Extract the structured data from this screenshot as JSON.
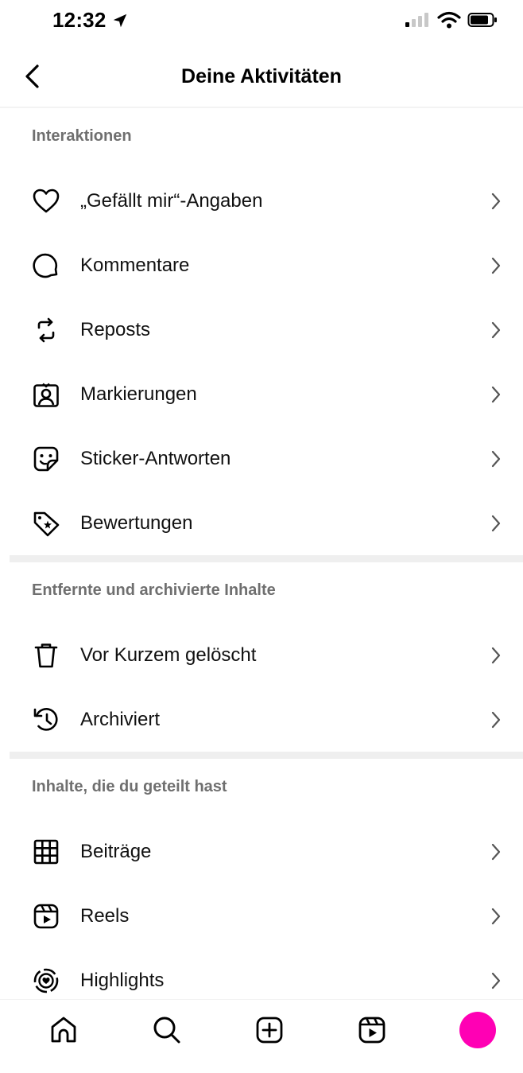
{
  "status_bar": {
    "time": "12:32"
  },
  "header": {
    "title": "Deine Aktivitäten"
  },
  "sections": [
    {
      "title": "Interaktionen",
      "items": [
        {
          "label": "„Gefällt mir“-Angaben",
          "icon": "heart-icon"
        },
        {
          "label": "Kommentare",
          "icon": "comment-icon"
        },
        {
          "label": "Reposts",
          "icon": "repost-icon"
        },
        {
          "label": "Markierungen",
          "icon": "tag-person-icon"
        },
        {
          "label": "Sticker-Antworten",
          "icon": "sticker-icon"
        },
        {
          "label": "Bewertungen",
          "icon": "rating-tag-icon"
        }
      ]
    },
    {
      "title": "Entfernte und archivierte Inhalte",
      "items": [
        {
          "label": "Vor Kurzem gelöscht",
          "icon": "trash-icon"
        },
        {
          "label": "Archiviert",
          "icon": "archive-history-icon"
        }
      ]
    },
    {
      "title": "Inhalte, die du geteilt hast",
      "items": [
        {
          "label": "Beiträge",
          "icon": "grid-icon"
        },
        {
          "label": "Reels",
          "icon": "reels-icon"
        },
        {
          "label": "Highlights",
          "icon": "highlights-icon"
        }
      ]
    }
  ],
  "tab_bar": {
    "items": [
      "home-icon",
      "search-icon",
      "create-icon",
      "reels-icon",
      "profile-avatar"
    ],
    "avatar_color": "#ff00b4"
  },
  "colors": {
    "section_header": "#6f6f6f",
    "divider": "#efefef",
    "text": "#111111"
  }
}
